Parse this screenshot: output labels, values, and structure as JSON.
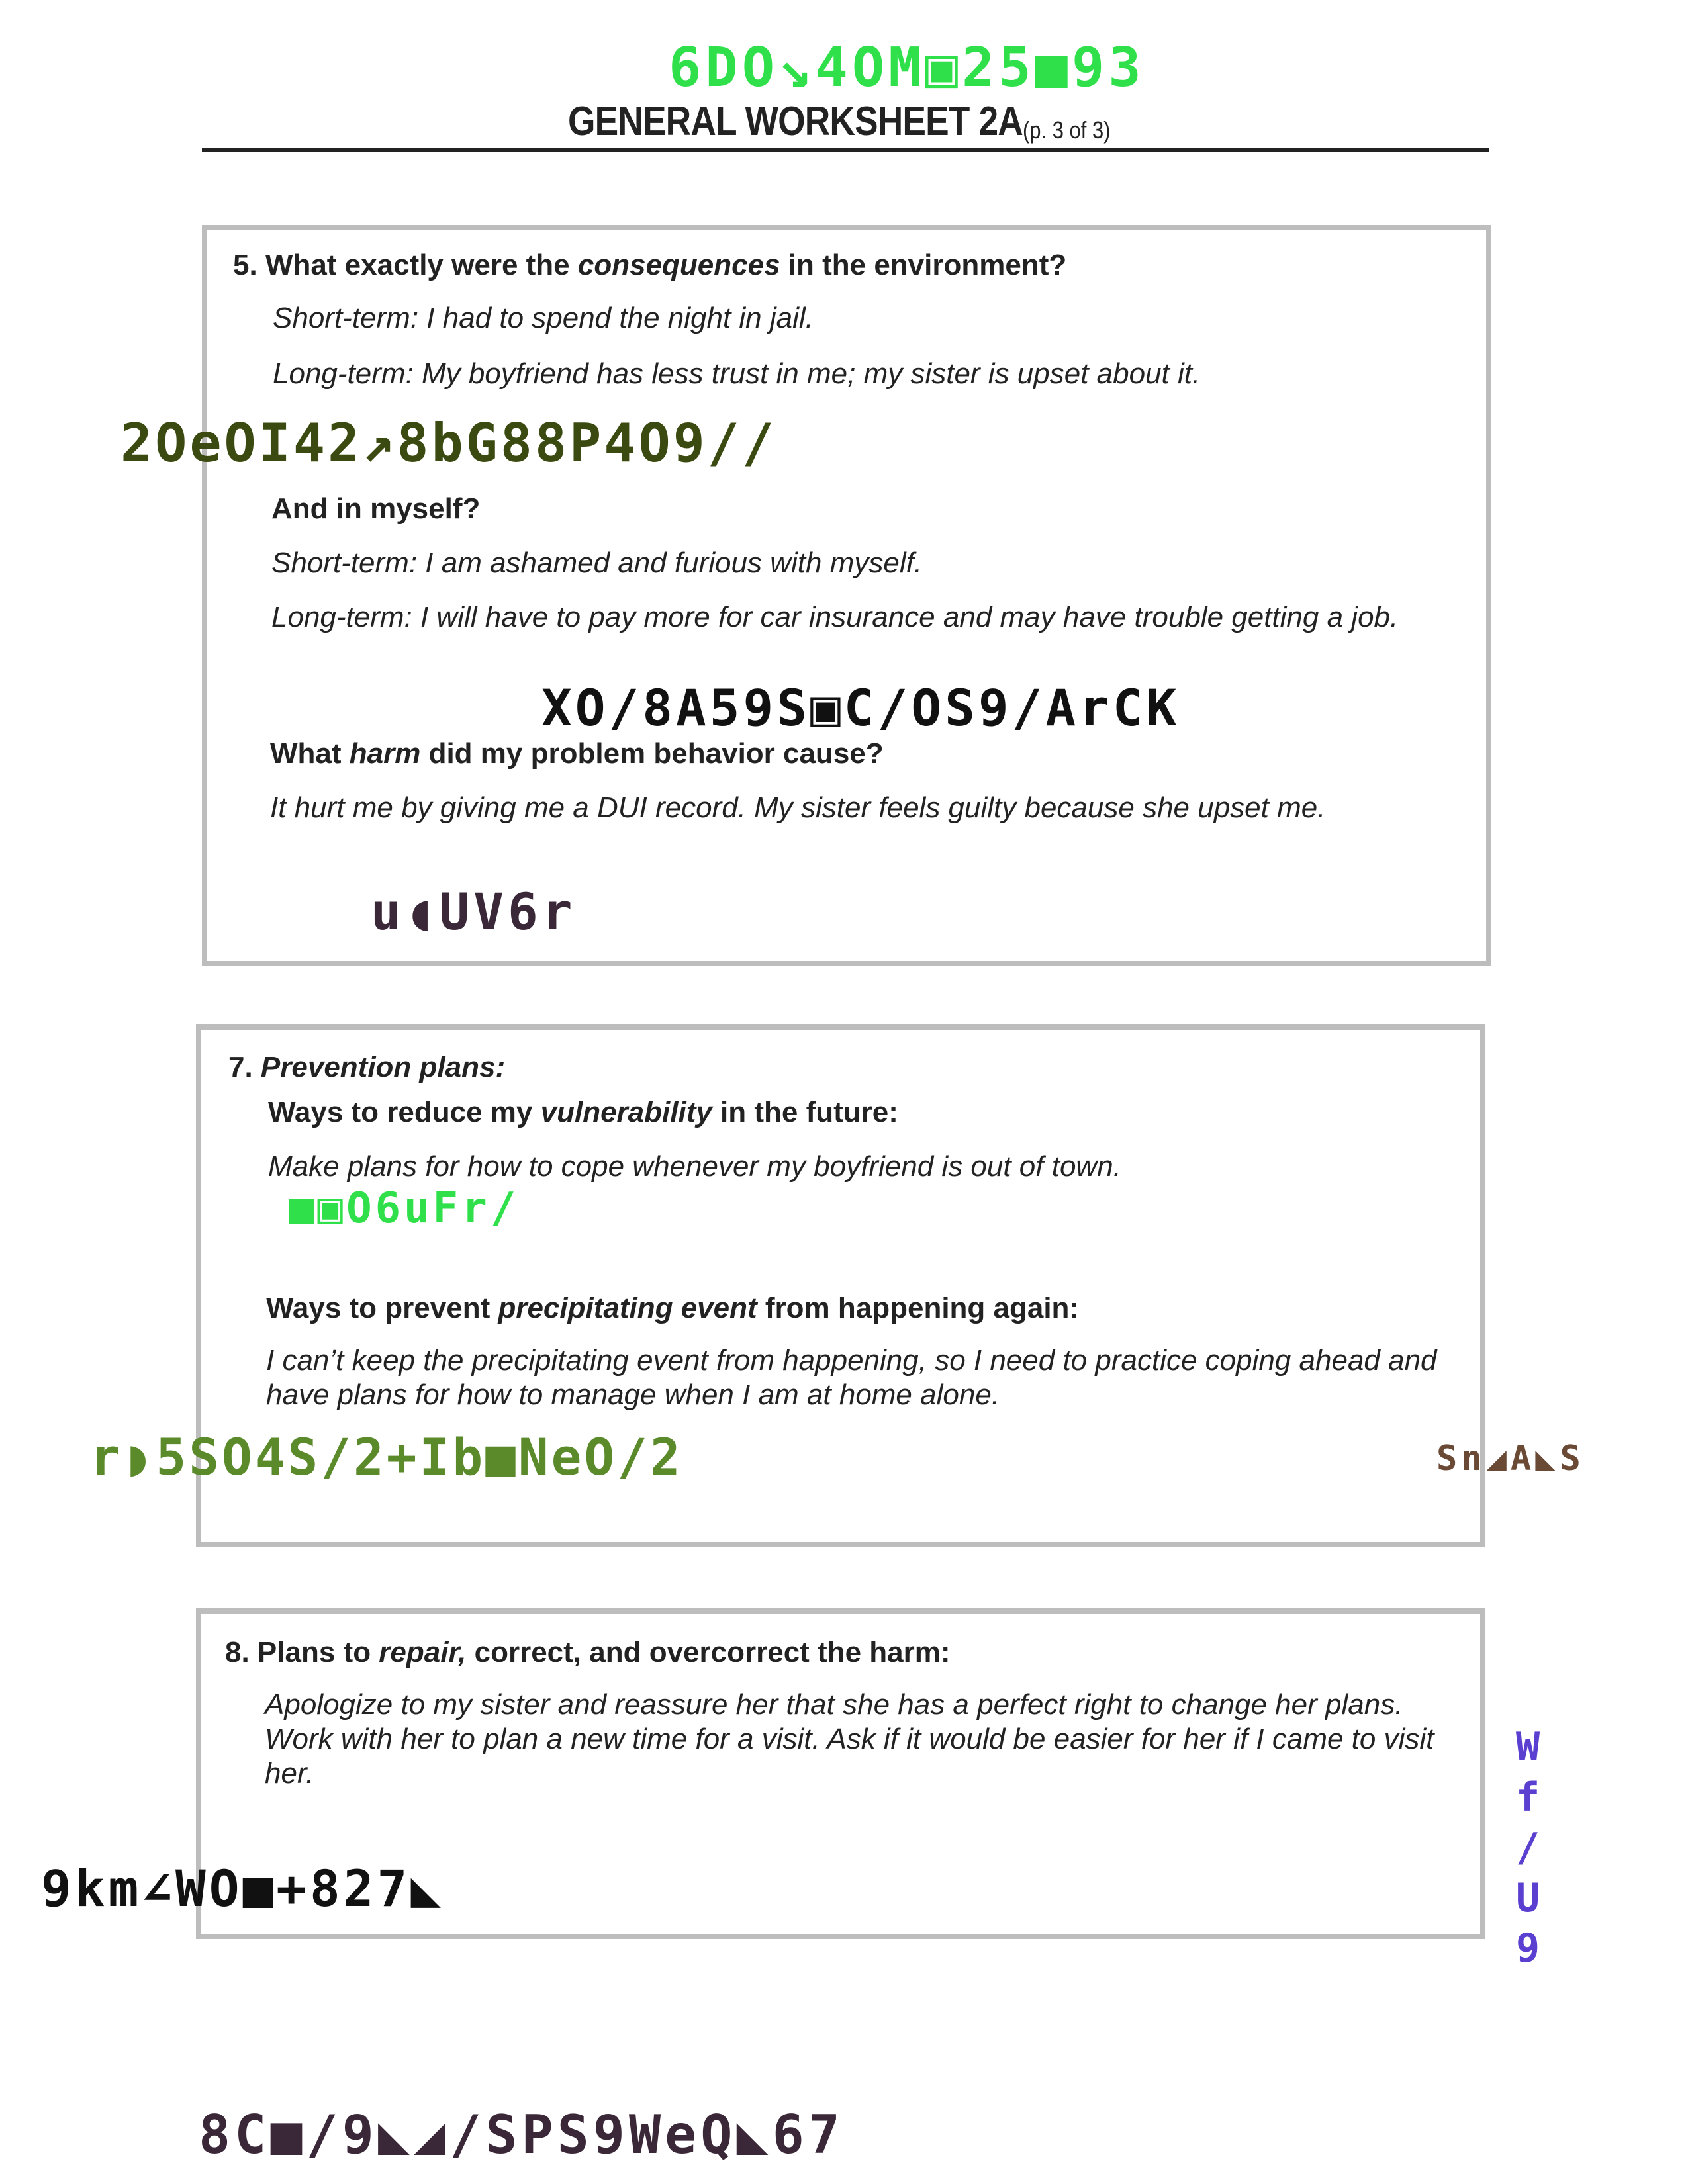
{
  "header": {
    "code": "6DO↘4OM▣25■93",
    "title": "GENERAL WORKSHEET 2A",
    "page": "(p. 3 of 3)"
  },
  "section5": {
    "q_prefix": "5.  What exactly were the ",
    "q_em": "consequences",
    "q_suffix": " in the environment?",
    "env_short": "Short-term: I had to spend the night in jail.",
    "env_long": "Long-term: My boyfriend has less trust in me; my sister is upset about it.",
    "self_q": "And in myself?",
    "self_short": "Short-term: I am ashamed and furious with myself.",
    "self_long": "Long-term: I will have to pay more for car insurance and may have trouble getting a job.",
    "harm_prefix": "What ",
    "harm_em": "harm",
    "harm_suffix": " did my problem behavior cause?",
    "harm_answer": "It hurt me by giving me a DUI record. My sister feels guilty because she upset me."
  },
  "section7": {
    "num": "7. ",
    "q": "Prevention plans:",
    "vuln_prefix": "Ways to reduce my ",
    "vuln_em": "vulnerability",
    "vuln_suffix": " in the future:",
    "vuln_answer": "Make plans for how to cope whenever my boyfriend is out of town.",
    "prev_prefix": "Ways to prevent ",
    "prev_em": "precipitating event",
    "prev_suffix": " from happening again:",
    "prev_answer": "I can’t keep the precipitating event from happening, so I need to practice coping ahead and have plans for how to manage when I am at home alone."
  },
  "section8": {
    "q_prefix": "8.  Plans to ",
    "q_em": "repair,",
    "q_suffix": " correct, and overcorrect the harm:",
    "answer": "Apologize to my sister and reassure her that she has a perfect right to change her plans. Work with her to plan a new time for a visit. Ask if it would be easier for her if I came to visit her."
  },
  "scribbles": {
    "s1": "2OeOI42↗8bG88P4O9//",
    "s2": "XO/8A59S▣C/OS9/ArCK",
    "s3": "u◖UV6r",
    "s4": "■▣O6uFr/",
    "s5": "r◗5SO4S/2+Ib■NeO/2",
    "s6": "Sn◢A◣S",
    "s7": [
      "W",
      "f",
      "/",
      "U",
      "9"
    ],
    "s8": "9km∠WO■+827◣",
    "s9": "8C■/9◣◢/SPS9WeQ◣67"
  },
  "colors": {
    "bright_green": "#2fe04a",
    "olive": "#3b4a10",
    "moss": "#5a8a2a",
    "brown": "#6b4a35",
    "purple": "#5b3fd0",
    "plum": "#3a2838",
    "ink": "#111111"
  }
}
